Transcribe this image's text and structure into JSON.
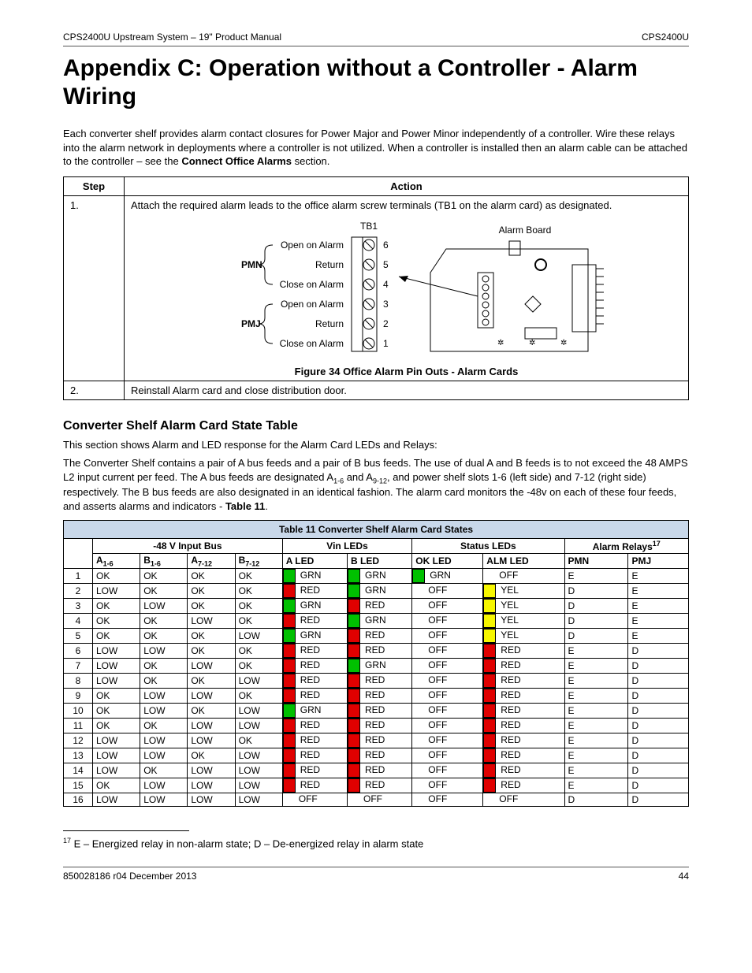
{
  "header": {
    "left": "CPS2400U Upstream System – 19\" Product Manual",
    "right": "CPS2400U"
  },
  "title": "Appendix C: Operation without a Controller - Alarm Wiring",
  "intro": "Each converter shelf provides alarm contact closures for Power Major and Power Minor independently of a controller. Wire these relays into the alarm network in deployments where a controller is not utilized. When a controller is installed then an alarm cable can be attached to the controller – see the ",
  "intro_ref": "Connect Office Alarms",
  "intro_tail": " section.",
  "steps": {
    "headers": [
      "Step",
      "Action"
    ],
    "rows": [
      {
        "step": "1.",
        "action": "Attach the required alarm leads to the office alarm screw terminals (TB1 on the alarm card) as designated."
      },
      {
        "step": "2.",
        "action": "Reinstall Alarm card and close distribution door."
      }
    ]
  },
  "figure": {
    "tb1_label": "TB1",
    "alarm_board_label": "Alarm Board",
    "pmn": "PMN",
    "pmj": "PMJ",
    "terms": [
      {
        "txt": "Open on Alarm",
        "num": "6"
      },
      {
        "txt": "Return",
        "num": "5"
      },
      {
        "txt": "Close on Alarm",
        "num": "4"
      },
      {
        "txt": "Open on Alarm",
        "num": "3"
      },
      {
        "txt": "Return",
        "num": "2"
      },
      {
        "txt": "Close on Alarm",
        "num": "1"
      }
    ],
    "caption": "Figure 34 Office Alarm Pin Outs - Alarm Cards"
  },
  "section2_title": "Converter Shelf Alarm Card State Table",
  "section2_p1": "This section shows Alarm and LED response for the Alarm Card LEDs and Relays:",
  "section2_p2a": "The Converter Shelf contains a pair of A bus feeds and a pair of B bus feeds. The use of dual A and B feeds is to not exceed the 48 AMPS L2 input current per feed. The A bus feeds are designated A",
  "section2_p2b": " and A",
  "section2_p2c": ", and power shelf slots 1-6 (left side) and 7-12 (right side) respectively. The B bus feeds are also designated in an identical fashion. The alarm card monitors the -48v on each of these four feeds, and asserts alarms and indicators - ",
  "table11_ref": "Table 11",
  "sub16": "1-6",
  "sub912": "9-12",
  "table11": {
    "title": "Table 11 Converter Shelf Alarm Card States",
    "groups": [
      "-48 V Input Bus",
      "Vin LEDs",
      "Status LEDs",
      "Alarm Relays"
    ],
    "relays_sup": "17",
    "cols": [
      "A1-6",
      "B1-6",
      "A7-12",
      "B7-12",
      "A LED",
      "B LED",
      "OK LED",
      "ALM LED",
      "PMN",
      "PMJ"
    ],
    "led_colors": {
      "GRN": "#00c000",
      "RED": "#e00000",
      "YEL": "#f7f700",
      "OFF": "#ffffff"
    },
    "rows": [
      {
        "n": 1,
        "bus": [
          "OK",
          "OK",
          "OK",
          "OK"
        ],
        "aled": "GRN",
        "bled": "GRN",
        "okled": "GRN",
        "almled": "OFF",
        "pmn": "E",
        "pmj": "E"
      },
      {
        "n": 2,
        "bus": [
          "LOW",
          "OK",
          "OK",
          "OK"
        ],
        "aled": "RED",
        "bled": "GRN",
        "okled": "OFF",
        "almled": "YEL",
        "pmn": "D",
        "pmj": "E"
      },
      {
        "n": 3,
        "bus": [
          "OK",
          "LOW",
          "OK",
          "OK"
        ],
        "aled": "GRN",
        "bled": "RED",
        "okled": "OFF",
        "almled": "YEL",
        "pmn": "D",
        "pmj": "E"
      },
      {
        "n": 4,
        "bus": [
          "OK",
          "OK",
          "LOW",
          "OK"
        ],
        "aled": "RED",
        "bled": "GRN",
        "okled": "OFF",
        "almled": "YEL",
        "pmn": "D",
        "pmj": "E"
      },
      {
        "n": 5,
        "bus": [
          "OK",
          "OK",
          "OK",
          "LOW"
        ],
        "aled": "GRN",
        "bled": "RED",
        "okled": "OFF",
        "almled": "YEL",
        "pmn": "D",
        "pmj": "E"
      },
      {
        "n": 6,
        "bus": [
          "LOW",
          "LOW",
          "OK",
          "OK"
        ],
        "aled": "RED",
        "bled": "RED",
        "okled": "OFF",
        "almled": "RED",
        "pmn": "E",
        "pmj": "D"
      },
      {
        "n": 7,
        "bus": [
          "LOW",
          "OK",
          "LOW",
          "OK"
        ],
        "aled": "RED",
        "bled": "GRN",
        "okled": "OFF",
        "almled": "RED",
        "pmn": "E",
        "pmj": "D"
      },
      {
        "n": 8,
        "bus": [
          "LOW",
          "OK",
          "OK",
          "LOW"
        ],
        "aled": "RED",
        "bled": "RED",
        "okled": "OFF",
        "almled": "RED",
        "pmn": "E",
        "pmj": "D"
      },
      {
        "n": 9,
        "bus": [
          "OK",
          "LOW",
          "LOW",
          "OK"
        ],
        "aled": "RED",
        "bled": "RED",
        "okled": "OFF",
        "almled": "RED",
        "pmn": "E",
        "pmj": "D"
      },
      {
        "n": 10,
        "bus": [
          "OK",
          "LOW",
          "OK",
          "LOW"
        ],
        "aled": "GRN",
        "bled": "RED",
        "okled": "OFF",
        "almled": "RED",
        "pmn": "E",
        "pmj": "D"
      },
      {
        "n": 11,
        "bus": [
          "OK",
          "OK",
          "LOW",
          "LOW"
        ],
        "aled": "RED",
        "bled": "RED",
        "okled": "OFF",
        "almled": "RED",
        "pmn": "E",
        "pmj": "D"
      },
      {
        "n": 12,
        "bus": [
          "LOW",
          "LOW",
          "LOW",
          "OK"
        ],
        "aled": "RED",
        "bled": "RED",
        "okled": "OFF",
        "almled": "RED",
        "pmn": "E",
        "pmj": "D"
      },
      {
        "n": 13,
        "bus": [
          "LOW",
          "LOW",
          "OK",
          "LOW"
        ],
        "aled": "RED",
        "bled": "RED",
        "okled": "OFF",
        "almled": "RED",
        "pmn": "E",
        "pmj": "D"
      },
      {
        "n": 14,
        "bus": [
          "LOW",
          "OK",
          "LOW",
          "LOW"
        ],
        "aled": "RED",
        "bled": "RED",
        "okled": "OFF",
        "almled": "RED",
        "pmn": "E",
        "pmj": "D"
      },
      {
        "n": 15,
        "bus": [
          "OK",
          "LOW",
          "LOW",
          "LOW"
        ],
        "aled": "RED",
        "bled": "RED",
        "okled": "OFF",
        "almled": "RED",
        "pmn": "E",
        "pmj": "D"
      },
      {
        "n": 16,
        "bus": [
          "LOW",
          "LOW",
          "LOW",
          "LOW"
        ],
        "aled": "OFF",
        "bled": "OFF",
        "okled": "OFF",
        "almled": "OFF",
        "pmn": "D",
        "pmj": "D"
      }
    ]
  },
  "footnote": {
    "num": "17",
    "text": " E – Energized relay in non-alarm state; D – De-energized relay in alarm state"
  },
  "footer": {
    "left": "850028186   r04   December 2013",
    "right": "44"
  }
}
